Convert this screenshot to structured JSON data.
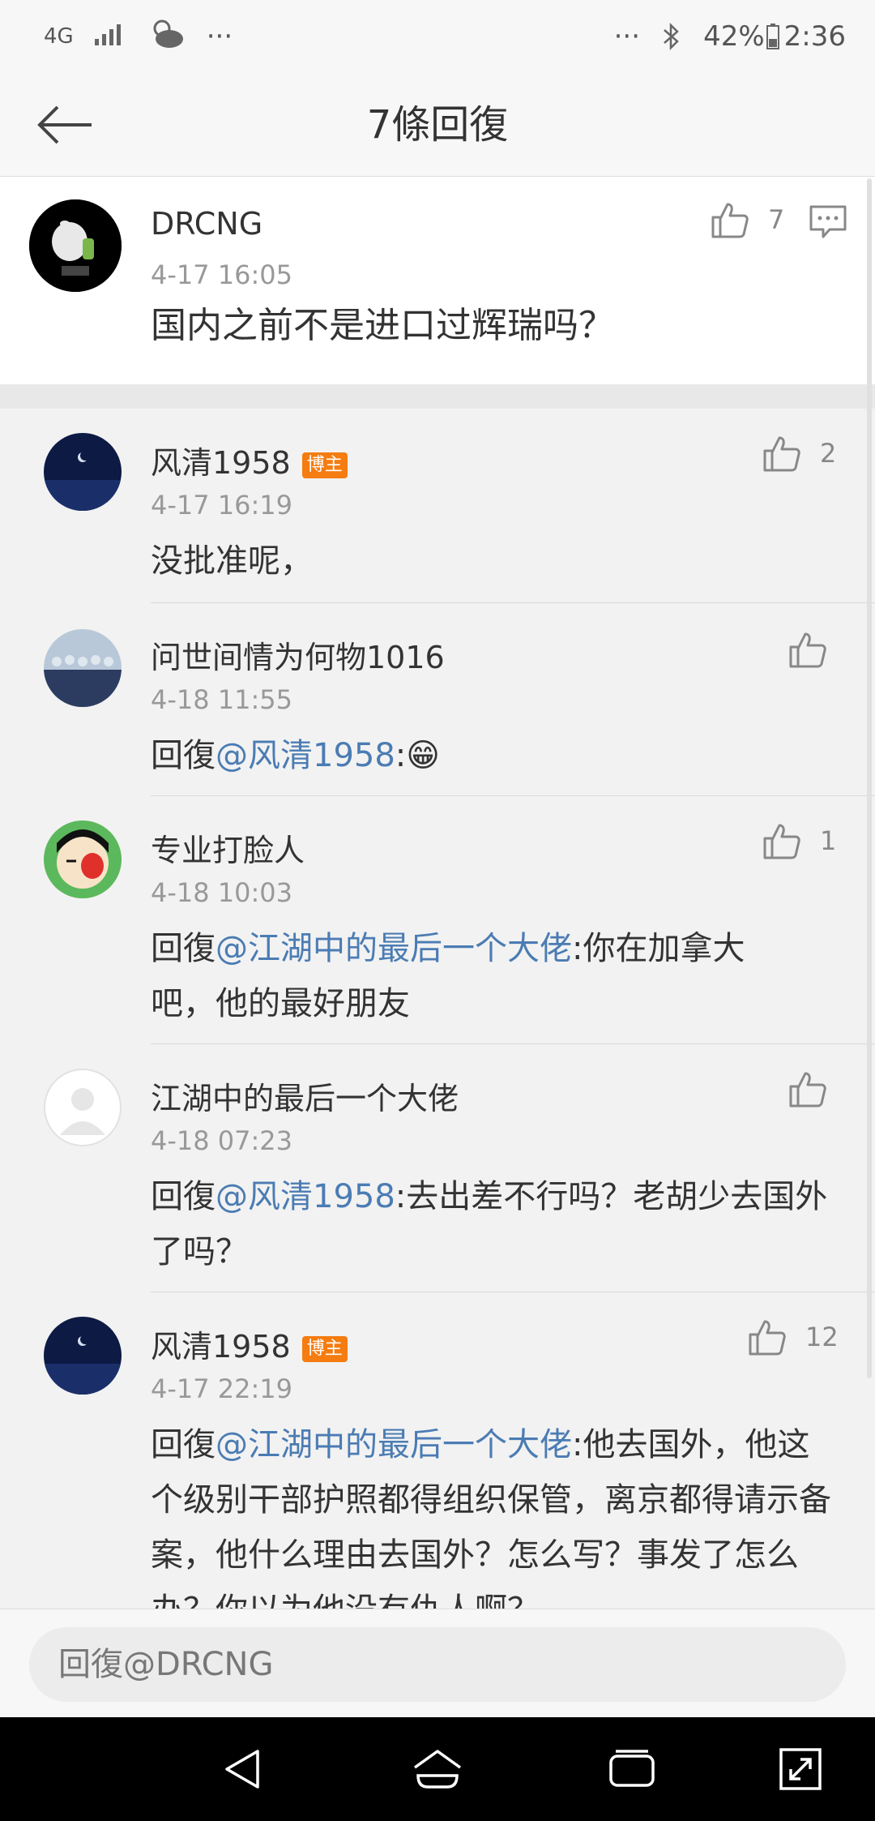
{
  "status_bar": {
    "network": "4G",
    "more": "···",
    "more_right": "···",
    "battery": "42%",
    "time": "2:36"
  },
  "header": {
    "title": "7條回復",
    "back_icon": "arrow-left-icon"
  },
  "main_comment": {
    "username": "DRCNG",
    "time": "4-17 16:05",
    "content": "国内之前不是进口过辉瑞吗？",
    "likes": "7"
  },
  "replies": [
    {
      "username": "风清1958",
      "badge": "博主",
      "time": "4-17 16:19",
      "prefix": "",
      "mention": "",
      "text": "没批准呢，",
      "likes": "2"
    },
    {
      "username": "问世间情为何物1016",
      "badge": "",
      "time": "4-18 11:55",
      "prefix": "回復",
      "mention": "@风清1958",
      "text": ":😁",
      "likes": ""
    },
    {
      "username": "专业打脸人",
      "badge": "",
      "time": "4-18 10:03",
      "prefix": "回復",
      "mention": "@江湖中的最后一个大佬",
      "text": ":你在加拿大吧，他的最好朋友",
      "likes": "1"
    },
    {
      "username": "江湖中的最后一个大佬",
      "badge": "",
      "time": "4-18 07:23",
      "prefix": "回復",
      "mention": "@风清1958",
      "text": ":去出差不行吗？老胡少去国外了吗？",
      "likes": ""
    },
    {
      "username": "风清1958",
      "badge": "博主",
      "time": "4-17 22:19",
      "prefix": "回復",
      "mention": "@江湖中的最后一个大佬",
      "text": ":他去国外，他这个级别干部护照都得组织保管，离京都得请示备案，他什么理由去国外？怎么写？事发了怎么办？你以为他没有仇人啊？，",
      "likes": "12"
    }
  ],
  "reply_box": {
    "placeholder": "回復@DRCNG"
  },
  "colors": {
    "link": "#4b7cb3",
    "badge": "#f57c10"
  }
}
